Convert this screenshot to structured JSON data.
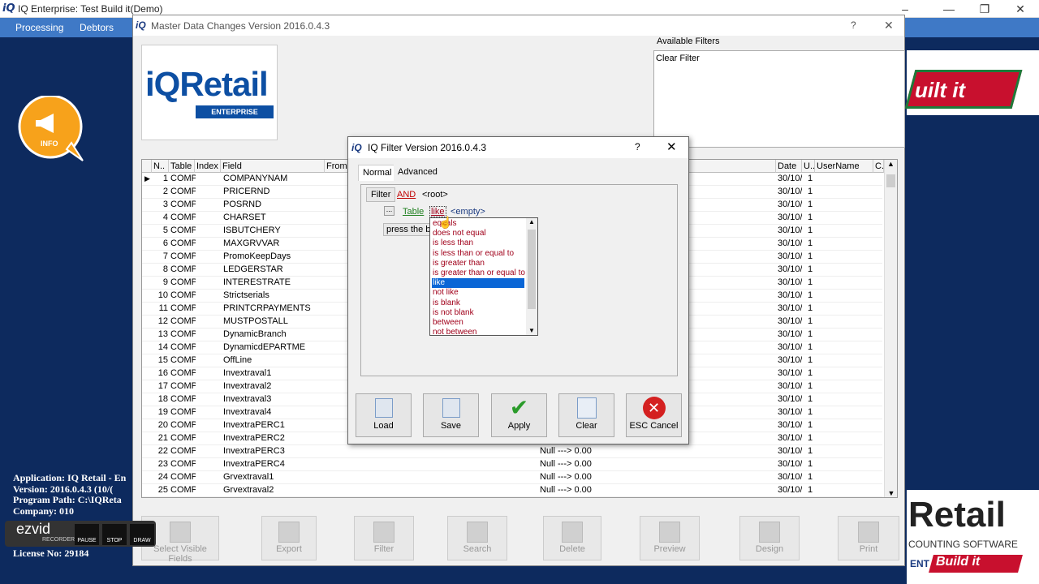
{
  "app": {
    "title": "IQ Enterprise: Test Build it(Demo)",
    "menu": [
      "Processing",
      "Debtors"
    ],
    "logo_text": "iQ"
  },
  "desktop": {
    "info_label": "INFO",
    "info_lines": [
      "Application: IQ Retail - En",
      "Version: 2016.0.4.3 (10/(",
      "Program Path: C:\\IQReta",
      "Company: 010",
      "License No: 29184"
    ],
    "right_brand_top": "uilt it",
    "right_brand_bottom": "Retail",
    "right_brand_sub": "COUNTING SOFTWARE",
    "right_brand_logo": "Build it",
    "right_brand_ent": "ENT"
  },
  "recorder": {
    "logo": "ezvid",
    "sub": "RECORDER",
    "buttons": [
      "PAUSE",
      "STOP",
      "DRAW"
    ]
  },
  "master": {
    "title": "Master Data Changes Version 2016.0.4.3",
    "logo_big": "iQRetail",
    "logo_sub": "ENTERPRISE",
    "filters_label": "Available Filters",
    "filters": [
      "Clear Filter"
    ],
    "headers": [
      "N..",
      "Table",
      "Index",
      "Field",
      "From",
      "Date",
      "U..",
      "UserName",
      "C.."
    ],
    "rows": [
      {
        "n": "1",
        "t": "COMPA",
        "f": "COMPANYNAM",
        "d": "30/10/",
        "u": "1"
      },
      {
        "n": "2",
        "t": "COMPA",
        "f": "PRICERND",
        "d": "30/10/",
        "u": "1"
      },
      {
        "n": "3",
        "t": "COMPA",
        "f": "POSRND",
        "d": "30/10/",
        "u": "1"
      },
      {
        "n": "4",
        "t": "COMPA",
        "f": "CHARSET",
        "d": "30/10/",
        "u": "1"
      },
      {
        "n": "5",
        "t": "COMPA",
        "f": "ISBUTCHERY",
        "d": "30/10/",
        "u": "1"
      },
      {
        "n": "6",
        "t": "COMPA",
        "f": "MAXGRVVAR",
        "d": "30/10/",
        "u": "1"
      },
      {
        "n": "7",
        "t": "COMPA",
        "f": "PromoKeepDays",
        "d": "30/10/",
        "u": "1"
      },
      {
        "n": "8",
        "t": "COMPA",
        "f": "LEDGERSTAR",
        "d": "30/10/",
        "u": "1"
      },
      {
        "n": "9",
        "t": "COMPA",
        "f": "INTERESTRATE",
        "d": "30/10/",
        "u": "1"
      },
      {
        "n": "10",
        "t": "COMPA",
        "f": "Strictserials",
        "d": "30/10/",
        "u": "1"
      },
      {
        "n": "11",
        "t": "COMPA",
        "f": "PRINTCRPAYMENTS",
        "d": "30/10/",
        "u": "1"
      },
      {
        "n": "12",
        "t": "COMPA",
        "f": "MUSTPOSTALL",
        "d": "30/10/",
        "u": "1"
      },
      {
        "n": "13",
        "t": "COMPA",
        "f": "DynamicBranch",
        "d": "30/10/",
        "u": "1"
      },
      {
        "n": "14",
        "t": "COMPA",
        "f": "DynamicdEPARTME",
        "d": "30/10/",
        "u": "1"
      },
      {
        "n": "15",
        "t": "COMPA",
        "f": "OffLine",
        "d": "30/10/",
        "u": "1"
      },
      {
        "n": "16",
        "t": "COMPA",
        "f": "Invextraval1",
        "d": "30/10/",
        "u": "1"
      },
      {
        "n": "17",
        "t": "COMPA",
        "f": "Invextraval2",
        "d": "30/10/",
        "u": "1"
      },
      {
        "n": "18",
        "t": "COMPA",
        "f": "Invextraval3",
        "d": "30/10/",
        "u": "1"
      },
      {
        "n": "19",
        "t": "COMPA",
        "f": "Invextraval4",
        "d": "30/10/",
        "u": "1"
      },
      {
        "n": "20",
        "t": "COMPA",
        "f": "InvextraPERC1",
        "d": "30/10/",
        "u": "1"
      },
      {
        "n": "21",
        "t": "COMPA",
        "f": "InvextraPERC2",
        "d": "30/10/",
        "u": "1"
      },
      {
        "n": "22",
        "t": "COMPA",
        "f": "InvextraPERC3",
        "c": "Null ---> 0.00",
        "d": "30/10/",
        "u": "1"
      },
      {
        "n": "23",
        "t": "COMPA",
        "f": "InvextraPERC4",
        "c": "Null ---> 0.00",
        "d": "30/10/",
        "u": "1"
      },
      {
        "n": "24",
        "t": "COMPA",
        "f": "Grvextraval1",
        "c": "Null ---> 0.00",
        "d": "30/10/",
        "u": "1"
      },
      {
        "n": "25",
        "t": "COMPA",
        "f": "Grvextraval2",
        "c": "Null ---> 0.00",
        "d": "30/10/",
        "u": "1"
      }
    ],
    "toolbar": [
      "Select Visible Fields",
      "Export",
      "Filter",
      "Search",
      "Delete",
      "Preview",
      "Design",
      "Print"
    ]
  },
  "filter_dialog": {
    "title": "IQ Filter Version 2016.0.4.3",
    "help": "?",
    "tabs": [
      "Normal",
      "Advanced"
    ],
    "filter_btn": "Filter",
    "and_label": "AND",
    "root_label": "<root>",
    "ellipsis": "...",
    "table_label": "Table",
    "op_label": "like",
    "empty_label": "<empty>",
    "press_text": "press the bu",
    "buttons": [
      "Load",
      "Save",
      "Apply",
      "Clear",
      "ESC Cancel"
    ],
    "operators": [
      "equals",
      "does not equal",
      "is less than",
      "is less than or equal to",
      "is greater than",
      "is greater than or equal to",
      "like",
      "not like",
      "is blank",
      "is not blank",
      "between",
      "not between"
    ],
    "selected_operator": "like"
  },
  "colors": {
    "menubar": "#3f79c6",
    "desktop": "#0d2a5e",
    "selection": "#0a66d6",
    "operator_text": "#a0001a",
    "and_red": "#c00000",
    "table_green": "#208020"
  }
}
